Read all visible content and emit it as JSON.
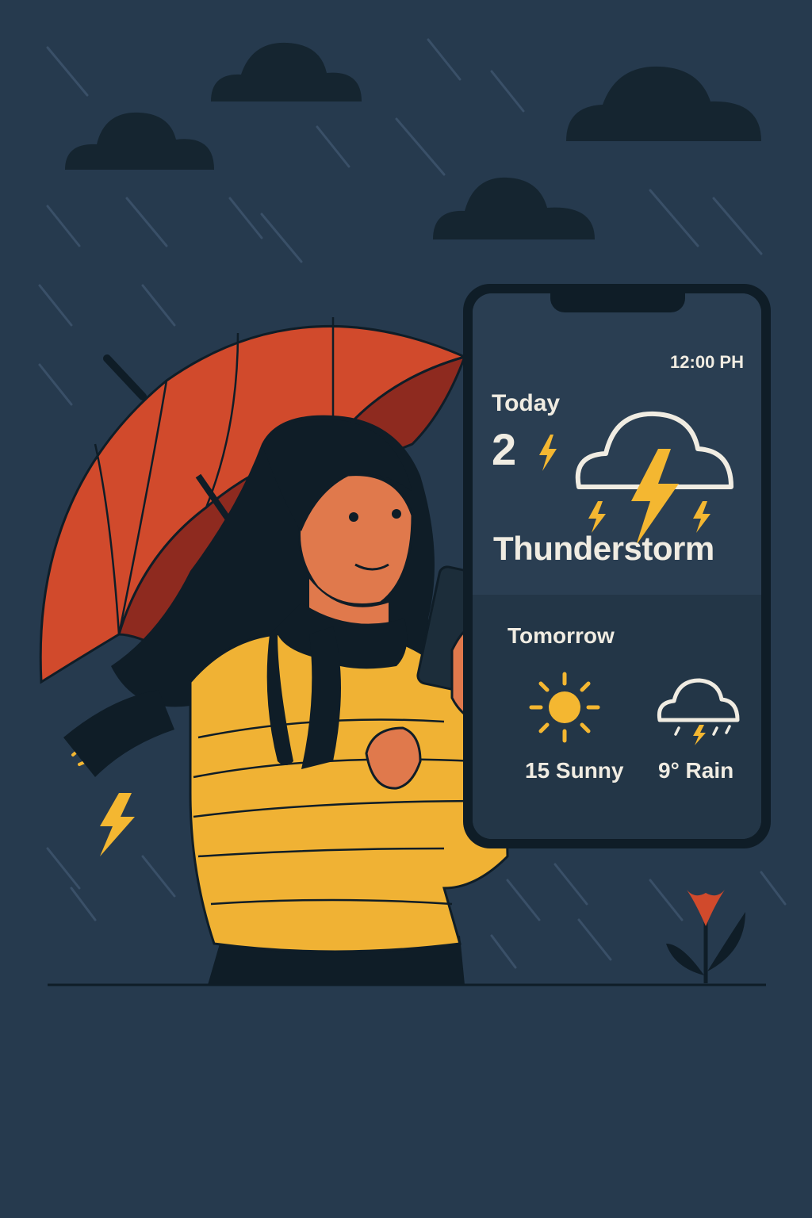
{
  "app": {
    "time": "12:00 PH",
    "today": {
      "label": "Today",
      "temperature": "2",
      "condition": "Thunderstorm",
      "icon": "thunderstorm-cloud-icon"
    },
    "tomorrow": {
      "label": "Tomorrow",
      "forecasts": [
        {
          "text": "15 Sunny",
          "icon": "sun-icon"
        },
        {
          "text": "9° Rain",
          "icon": "rain-cloud-icon"
        }
      ]
    }
  },
  "colors": {
    "background": "#263a4e",
    "phone_frame": "#0f1d27",
    "screen_top": "#2a3e52",
    "screen_bottom": "#233647",
    "accent_yellow": "#f4b731",
    "umbrella": "#d14a2c",
    "sweater": "#f0b234",
    "text": "#f0ece2"
  }
}
